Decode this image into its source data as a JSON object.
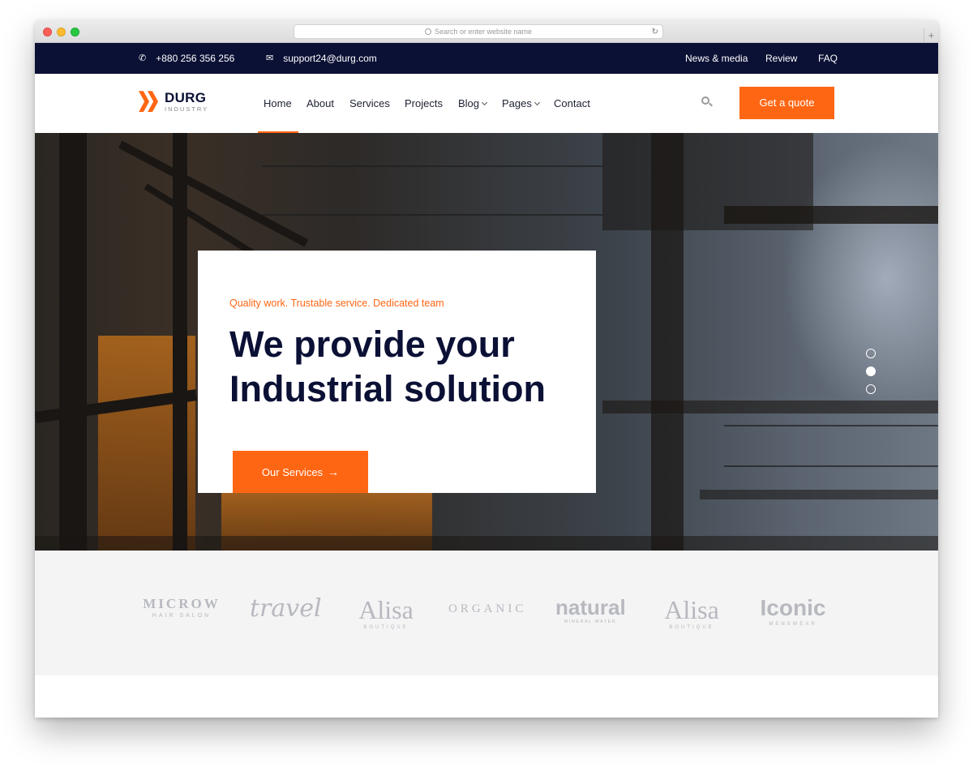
{
  "browser": {
    "url_placeholder": "Search or enter website name",
    "reload_icon": "reload-icon",
    "new_tab": "+"
  },
  "topbar": {
    "phone": "+880 256 356 256",
    "email": "support24@durg.com",
    "links": [
      "News & media",
      "Review",
      "FAQ"
    ]
  },
  "header": {
    "logo_title": "DURG",
    "logo_subtitle": "INDUSTRY",
    "nav": [
      {
        "label": "Home",
        "active": true
      },
      {
        "label": "About"
      },
      {
        "label": "Services"
      },
      {
        "label": "Projects"
      },
      {
        "label": "Blog",
        "dropdown": true
      },
      {
        "label": "Pages",
        "dropdown": true
      },
      {
        "label": "Contact"
      }
    ],
    "quote_button": "Get a quote"
  },
  "hero": {
    "tagline": "Quality work. Trustable service. Dedicated team",
    "title": "We provide your\nIndustrial solution",
    "button": "Our Services",
    "button_arrow": "→",
    "slides": 3,
    "active_slide": 2
  },
  "partners": [
    {
      "name": "MICROW",
      "sub": "HAIR SALON"
    },
    {
      "name": "travel",
      "sub": ""
    },
    {
      "name": "Alisa",
      "sub": "BOUTIQUE"
    },
    {
      "name": "ORGANIC",
      "sub": ""
    },
    {
      "name": "natural",
      "sub": "MINERAL WATER"
    },
    {
      "name": "Alisa",
      "sub": "BOUTIQUE"
    },
    {
      "name": "Iconic",
      "sub": "MENSWEAR"
    }
  ],
  "colors": {
    "accent": "#ff6613",
    "navy": "#0b1035",
    "partner_bg": "#f4f4f5"
  }
}
